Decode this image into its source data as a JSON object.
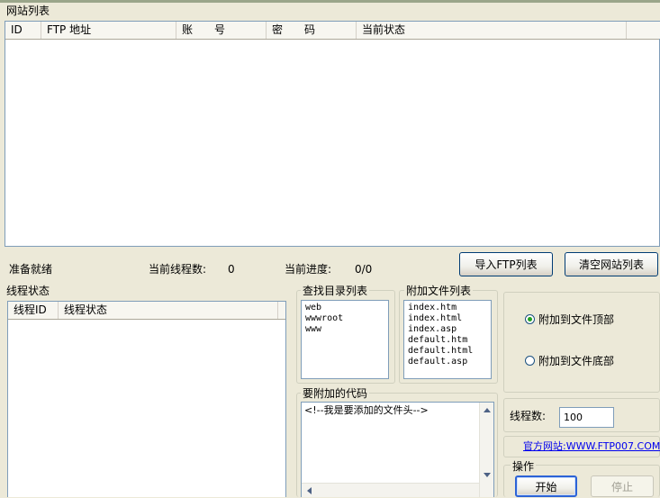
{
  "site_list": {
    "title": "网站列表",
    "columns": [
      "ID",
      "FTP 地址",
      "账　　号",
      "密　　码",
      "当前状态"
    ]
  },
  "status_bar": {
    "ready": "准备就绪",
    "thread_count_label": "当前线程数:",
    "thread_count_value": "0",
    "progress_label": "当前进度:",
    "progress_value": "0/0"
  },
  "buttons": {
    "import_ftp": "导入FTP列表",
    "clear_sites": "清空网站列表",
    "start": "开始",
    "stop": "停止"
  },
  "thread_status": {
    "title": "线程状态",
    "columns": [
      "线程ID",
      "线程状态"
    ]
  },
  "search_dirs": {
    "title": "查找目录列表",
    "items": [
      "web",
      "wwwroot",
      "www"
    ]
  },
  "attach_files": {
    "title": "附加文件列表",
    "items": [
      "index.htm",
      "index.html",
      "index.asp",
      "default.htm",
      "default.html",
      "default.asp"
    ]
  },
  "position": {
    "options": [
      "附加到文件顶部",
      "附加到文件底部"
    ],
    "selected": 0
  },
  "code": {
    "title": "要附加的代码",
    "value": "<!--我是要添加的文件头-->"
  },
  "threads": {
    "label": "线程数:",
    "value": "100"
  },
  "official_site": {
    "text": "官方网站:WWW.FTP007.COM"
  },
  "operation": {
    "label": "操作"
  }
}
